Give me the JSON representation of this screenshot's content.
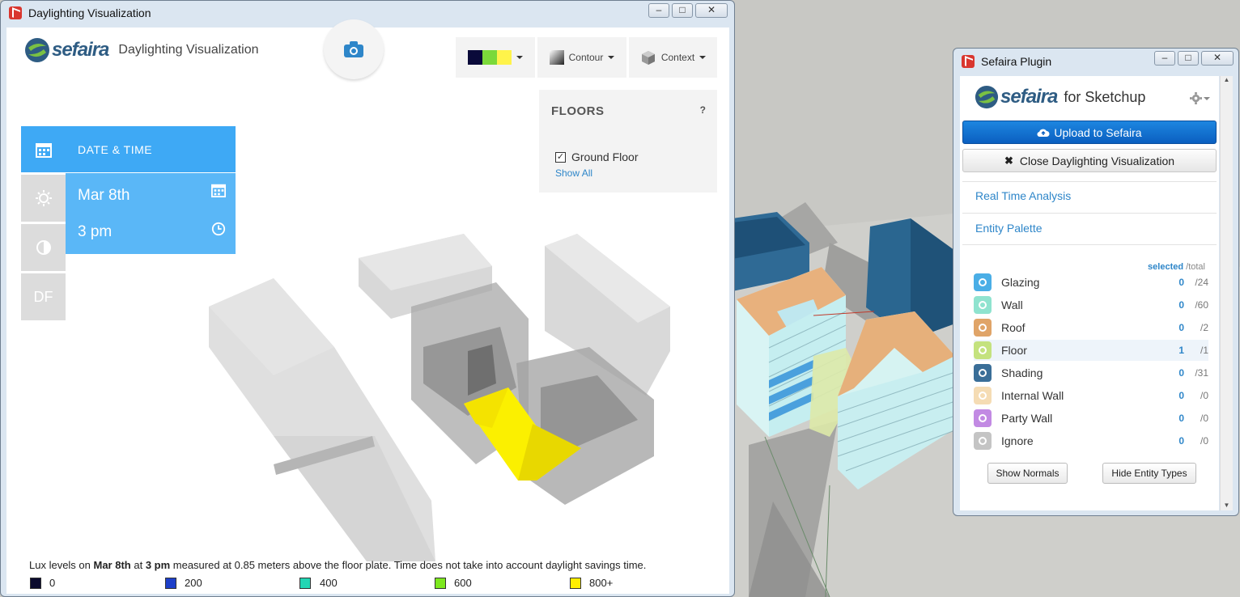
{
  "viz_window": {
    "title": "Daylighting Visualization",
    "controls": {
      "minimize": "▭",
      "maximize": "□",
      "close": "✕"
    },
    "brand": {
      "logo": "sefaira",
      "subtitle": "Daylighting Visualization"
    },
    "toolbar": {
      "camera_icon": "camera-icon",
      "palette_colors": [
        "#0a0a3a",
        "#7bd93a",
        "#fff34a"
      ],
      "contour_label": "Contour",
      "context_label": "Context"
    },
    "floors": {
      "heading": "FLOORS",
      "help": "?",
      "items": [
        {
          "label": "Ground Floor",
          "checked": true
        }
      ],
      "show_all": "Show All"
    },
    "date_time": {
      "heading": "DATE & TIME",
      "date": "Mar 8th",
      "time": "3 pm"
    },
    "side_tabs": [
      {
        "icon": "calendar-icon"
      },
      {
        "icon": "sun-icon"
      },
      {
        "icon": "contrast-icon"
      },
      {
        "label": "DF"
      }
    ],
    "footer": {
      "prefix": "Lux levels on ",
      "date": "Mar 8th",
      "mid": " at ",
      "time": "3 pm",
      "suffix": " measured at 0.85 meters above the floor plate. Time does not take into account daylight savings time."
    },
    "legend": [
      {
        "label": "0",
        "color": "#0b0b2e"
      },
      {
        "label": "200",
        "color": "#1d3fc9"
      },
      {
        "label": "400",
        "color": "#22d6b4"
      },
      {
        "label": "600",
        "color": "#7de81f"
      },
      {
        "label": "800+",
        "color": "#ffee00"
      }
    ]
  },
  "plugin_window": {
    "title": "Sefaira Plugin",
    "controls": {
      "minimize": "▭",
      "maximize": "□",
      "close": "✕"
    },
    "brand": {
      "logo": "sefaira",
      "subtitle": "for Sketchup"
    },
    "settings_icon": "gear-icon",
    "upload_label": "Upload to Sefaira",
    "close_viz_label": "Close Daylighting Visualization",
    "links": [
      "Real Time Analysis",
      "Entity Palette"
    ],
    "col_selected": "selected",
    "col_total": "/total",
    "entities": [
      {
        "name": "Glazing",
        "selected": "0",
        "total": "/24",
        "color": "#4aaee6"
      },
      {
        "name": "Wall",
        "selected": "0",
        "total": "/60",
        "color": "#8fe3cf"
      },
      {
        "name": "Roof",
        "selected": "0",
        "total": "/2",
        "color": "#e0a468"
      },
      {
        "name": "Floor",
        "selected": "1",
        "total": "/1",
        "color": "#c4e27e"
      },
      {
        "name": "Shading",
        "selected": "0",
        "total": "/31",
        "color": "#3a6e98"
      },
      {
        "name": "Internal Wall",
        "selected": "0",
        "total": "/0",
        "color": "#f5dcb4"
      },
      {
        "name": "Party Wall",
        "selected": "0",
        "total": "/0",
        "color": "#c28ae3"
      },
      {
        "name": "Ignore",
        "selected": "0",
        "total": "/0",
        "color": "#c4c4c4"
      }
    ],
    "show_normals_label": "Show Normals",
    "hide_types_label": "Hide Entity Types"
  }
}
